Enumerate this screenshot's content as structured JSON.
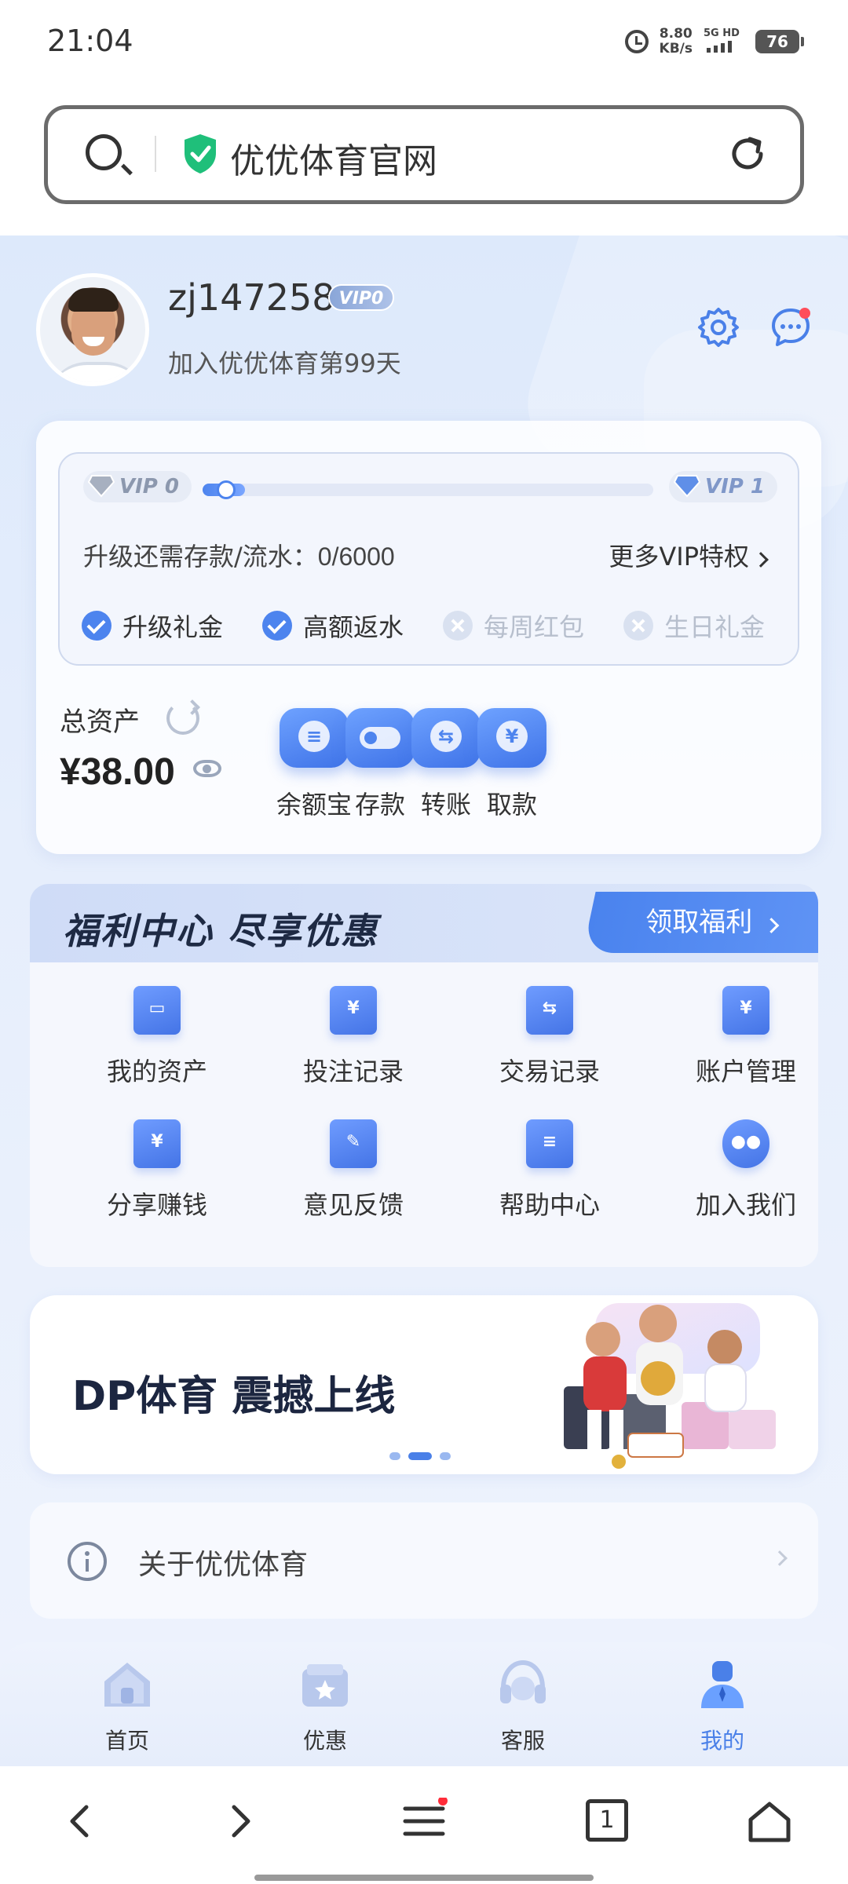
{
  "status_bar": {
    "time": "21:04",
    "net_speed_value": "8.80",
    "net_speed_unit": "KB/s",
    "network": "5G HD",
    "battery": "76"
  },
  "address_bar": {
    "title": "优优体育官网"
  },
  "profile": {
    "username": "zj147258",
    "vip_badge": "VIP0",
    "join_text": "加入优优体育第99天"
  },
  "vip": {
    "current_level": "VIP 0",
    "next_level": "VIP 1",
    "progress": 0,
    "upgrade_label": "升级还需存款/流水：",
    "upgrade_value": "0/6000",
    "more_label": "更多VIP特权",
    "perks": [
      {
        "label": "升级礼金",
        "unlocked": true
      },
      {
        "label": "高额返水",
        "unlocked": true
      },
      {
        "label": "每周红包",
        "unlocked": false
      },
      {
        "label": "生日礼金",
        "unlocked": false
      }
    ]
  },
  "assets": {
    "total_label": "总资产",
    "total_value": "¥38.00",
    "actions": [
      "余额宝",
      "存款",
      "转账",
      "取款"
    ]
  },
  "welfare": {
    "title": "福利中心  尽享优惠",
    "button_label": "领取福利",
    "items": [
      "我的资产",
      "投注记录",
      "交易记录",
      "账户管理",
      "分享赚钱",
      "意见反馈",
      "帮助中心",
      "加入我们"
    ]
  },
  "banner": {
    "text": "DP体育 震撼上线",
    "dots": 3,
    "active_dot": 1
  },
  "about": {
    "label": "关于优优体育"
  },
  "tabbar": {
    "items": [
      "首页",
      "优惠",
      "客服",
      "我的"
    ],
    "active_index": 3
  },
  "browser": {
    "tab_count": "1"
  },
  "colors": {
    "accent": "#4a80e8",
    "alert": "#ff4d5a",
    "shield": "#1fbf7a"
  }
}
